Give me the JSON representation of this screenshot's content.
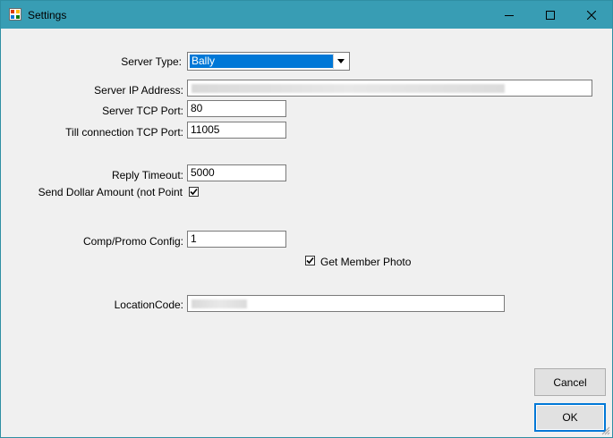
{
  "window": {
    "title": "Settings"
  },
  "form": {
    "server_type": {
      "label": "Server Type:",
      "value": "Bally"
    },
    "server_ip": {
      "label": "Server IP Address:",
      "value": ""
    },
    "server_tcp_port": {
      "label": "Server TCP Port:",
      "value": "80"
    },
    "till_tcp_port": {
      "label": "Till connection TCP Port:",
      "value": "11005"
    },
    "reply_timeout": {
      "label": "Reply Timeout:",
      "value": "5000"
    },
    "send_dollar": {
      "label": "Send Dollar Amount (not Point",
      "checked": true
    },
    "comp_promo": {
      "label": "Comp/Promo Config:",
      "value": "1"
    },
    "member_photo": {
      "label": "Get Member Photo",
      "checked": true
    },
    "location_code": {
      "label": "LocationCode:",
      "value": ""
    }
  },
  "buttons": {
    "cancel": "Cancel",
    "ok": "OK"
  },
  "colors": {
    "titlebar": "#389db4",
    "selection": "#0078d7",
    "background": "#f0f0f0"
  }
}
